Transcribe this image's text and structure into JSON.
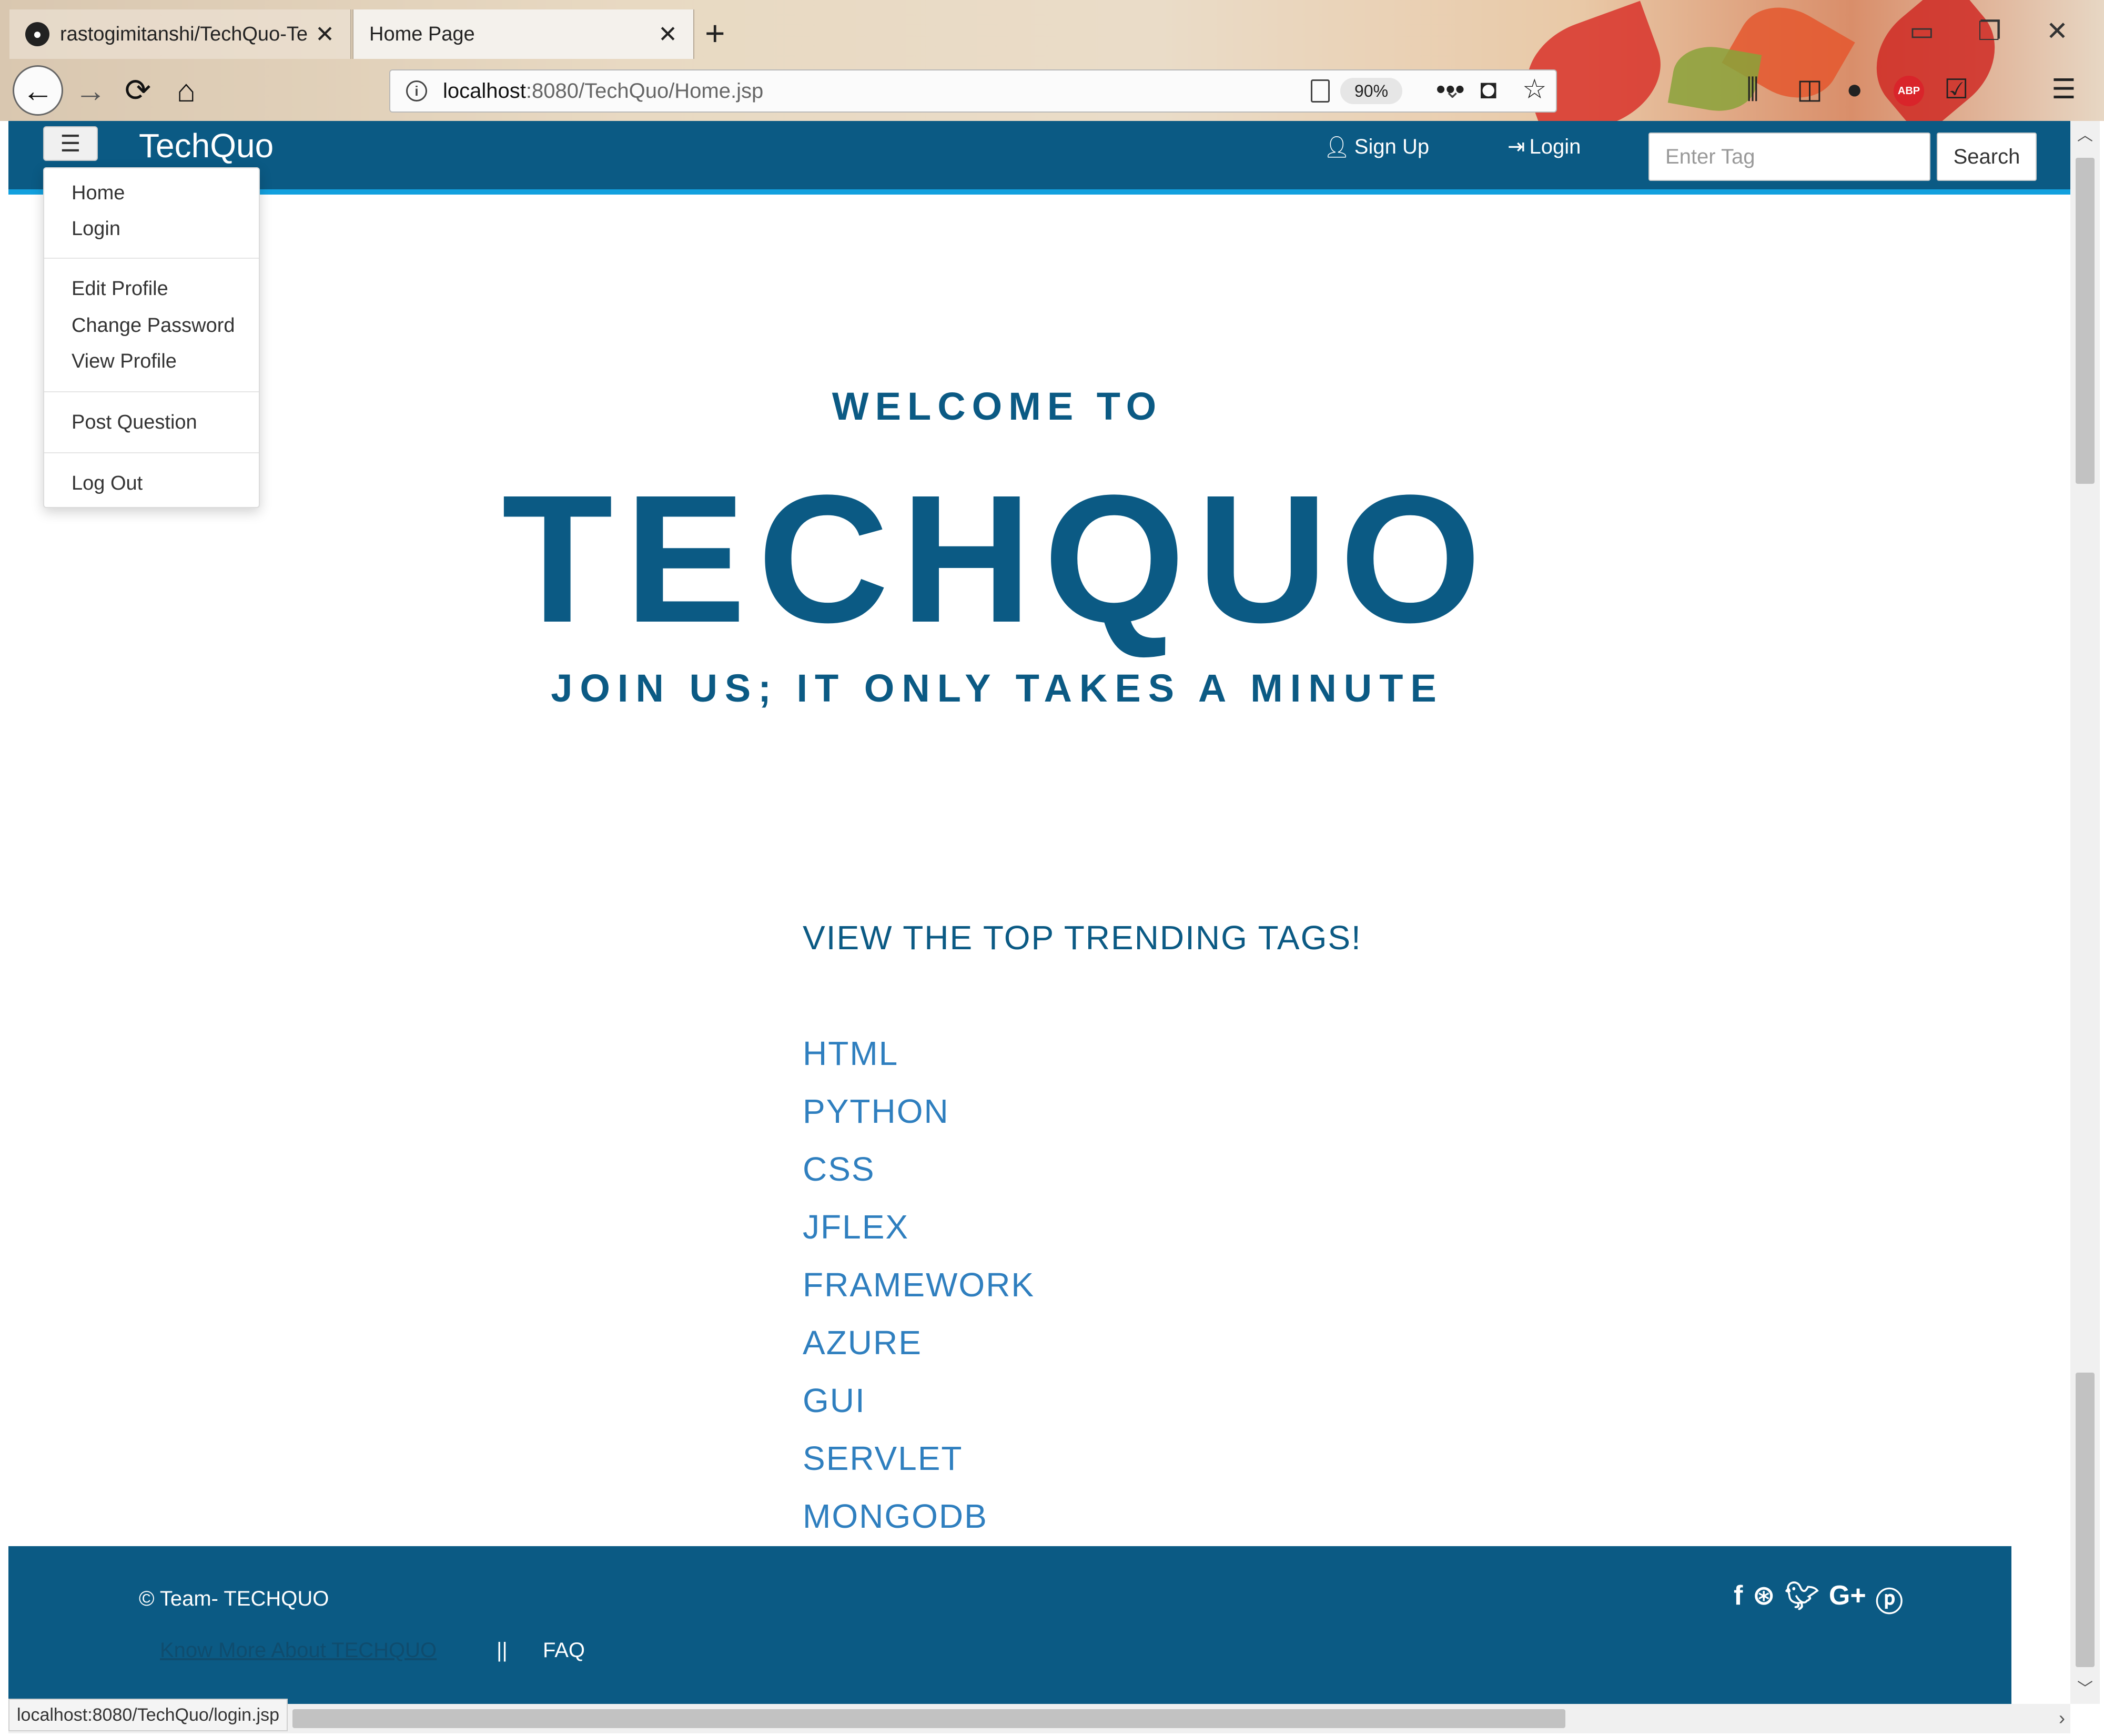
{
  "browser": {
    "tabs": [
      {
        "title": "rastogimitanshi/TechQuo-Tech",
        "active": false
      },
      {
        "title": "Home Page",
        "active": true
      }
    ],
    "url_host": "localhost",
    "url_path": ":8080/TechQuo/Home.jsp",
    "zoom": "90%",
    "status_url": "localhost:8080/TechQuo/login.jsp",
    "icons": [
      "github-icon",
      "back-arrow-icon",
      "forward-arrow-icon",
      "reload-icon",
      "home-icon",
      "info-icon",
      "reader-view-icon",
      "more-icon",
      "pocket-icon",
      "bookmark-star-icon",
      "library-icon",
      "sidebar-icon",
      "lightbulb-icon",
      "adblock-icon",
      "todo-icon",
      "menu-icon"
    ]
  },
  "navbar": {
    "brand": "TechQuo",
    "signup": "Sign Up",
    "login": "Login",
    "search_placeholder": "Enter Tag",
    "search_button": "Search",
    "accent": "#0b5a84"
  },
  "dropdown": {
    "items": [
      "Home",
      "Login",
      "Edit Profile",
      "Change Password",
      "View Profile",
      "Post Question",
      "Log Out"
    ]
  },
  "hero": {
    "welcome": "WELCOME TO",
    "title": "TECHQUO",
    "tagline": "JOIN US; IT ONLY TAKES A MINUTE"
  },
  "trending": {
    "heading": "VIEW THE TOP TRENDING TAGS!",
    "tags": [
      "HTML",
      "PYTHON",
      "CSS",
      "JFLEX",
      "FRAMEWORK",
      "AZURE",
      "GUI",
      "SERVLET",
      "MONGODB"
    ]
  },
  "footer": {
    "copyright": "© Team- TECHQUO",
    "know_more": "Know More About TECHQUO",
    "separator": "||",
    "faq": "FAQ",
    "social": [
      "facebook-icon",
      "dribbble-icon",
      "twitter-icon",
      "google-plus-icon",
      "pinterest-icon"
    ]
  }
}
